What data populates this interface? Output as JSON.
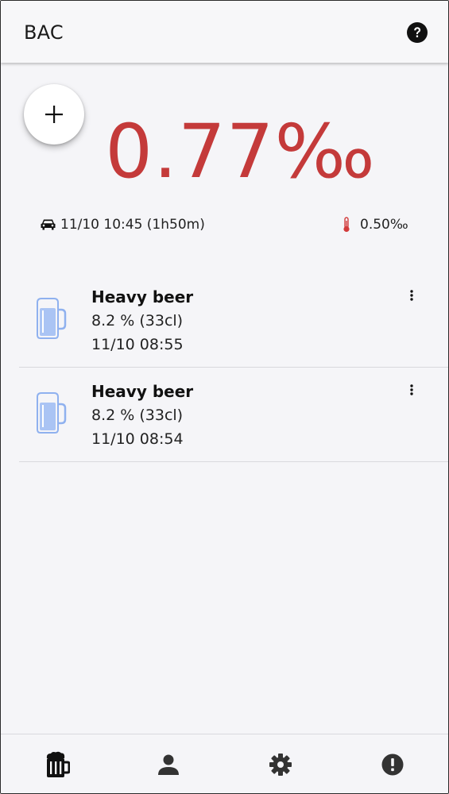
{
  "app": {
    "title": "BAC"
  },
  "bac": {
    "current": "0.77‰",
    "color": "#c43a3a"
  },
  "sober": {
    "icon": "car-icon",
    "time_text": "11/10 10:45 (1h50m)"
  },
  "peak": {
    "icon": "thermometer-icon",
    "value": "0.50‰"
  },
  "drinks": [
    {
      "name": "Heavy beer",
      "detail": "8.2 % (33cl)",
      "time": "11/10 08:55",
      "icon": "beer-mug-icon"
    },
    {
      "name": "Heavy beer",
      "detail": "8.2 % (33cl)",
      "time": "11/10 08:54",
      "icon": "beer-mug-icon"
    }
  ],
  "nav": {
    "items": [
      {
        "name": "drinks",
        "icon": "beer-icon",
        "active": true
      },
      {
        "name": "profile",
        "icon": "person-icon",
        "active": false
      },
      {
        "name": "settings",
        "icon": "gear-icon",
        "active": false
      },
      {
        "name": "info",
        "icon": "alert-icon",
        "active": false
      }
    ]
  },
  "colors": {
    "accent": "#c43a3a",
    "mug": "#aac4f4",
    "mug_outline": "#8fb1ef"
  }
}
